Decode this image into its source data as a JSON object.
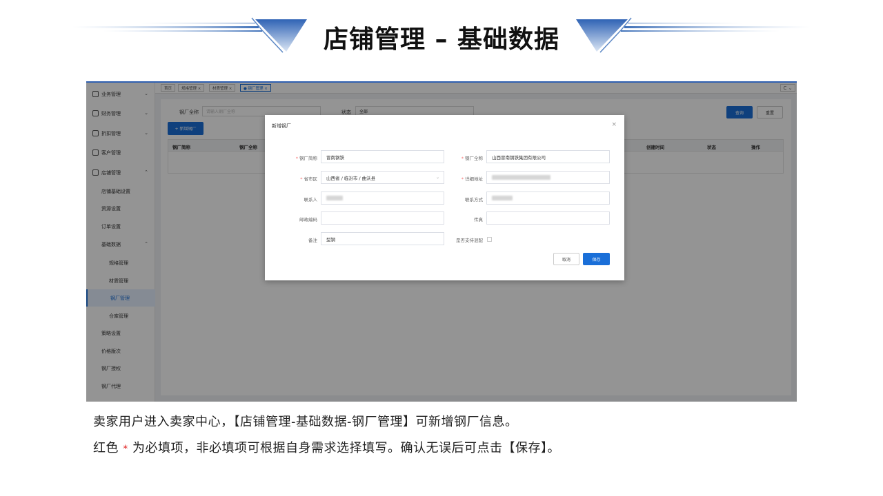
{
  "slide": {
    "title": "店铺管理 – 基础数据",
    "caption_line1": "卖家用户进入卖家中心，【店铺管理-基础数据-钢厂管理】可新增钢厂信息。",
    "caption_line2_before": "红色",
    "caption_line2_star": "*",
    "caption_line2_after": "为必填项，非必填项可根据自身需求选择填写。确认无误后可点击【保存】。"
  },
  "colors": {
    "primary": "#1a6fd8",
    "required": "#f56c6c",
    "accent_header": "#2f5fb0"
  },
  "sidebar": {
    "items": [
      {
        "label": "业务管理",
        "icon": "briefcase-icon",
        "chevron": "⌄"
      },
      {
        "label": "财务管理",
        "icon": "wallet-icon",
        "chevron": "⌄"
      },
      {
        "label": "折扣管理",
        "icon": "tag-icon",
        "chevron": "⌄"
      },
      {
        "label": "客户管理",
        "icon": "user-icon",
        "chevron": ""
      },
      {
        "label": "店铺管理",
        "icon": "shop-icon",
        "chevron": "⌃"
      }
    ],
    "sub_items": [
      "店铺基础设置",
      "资源设置",
      "订单设置",
      "基础数据"
    ],
    "sub_chevron": "⌃",
    "sub2_items": [
      "规格管理",
      "材质管理",
      "钢厂管理",
      "仓库管理"
    ],
    "tail_items": [
      "策略设置",
      "价格版次",
      "钢厂授权",
      "钢厂代理"
    ]
  },
  "tabs": {
    "items": [
      "首页",
      "规格管理 ×",
      "材质管理 ×",
      "● 钢厂管理 ×"
    ],
    "refresh": "C ⌄"
  },
  "filters": {
    "name_label": "钢厂全称",
    "name_placeholder": "请输入钢厂全称",
    "status_label": "状态",
    "status_value": "全部",
    "search_button": "查询",
    "reset_button": "重置",
    "add_button": "+ 新增钢厂"
  },
  "table": {
    "headers": [
      "钢厂简称",
      "钢厂全称",
      "创建时间",
      "状态",
      "操作"
    ]
  },
  "dialog": {
    "title": "新增钢厂",
    "close": "×",
    "fields": {
      "short_name": {
        "label": "钢厂简称",
        "required": "*",
        "value": "冒南钢铁"
      },
      "full_name": {
        "label": "钢厂全称",
        "required": "*",
        "value": "山西冒南钢铁集团有限公司"
      },
      "region": {
        "label": "省市区",
        "required": "*",
        "value": "山西省 / 临汾市 / 曲沃县",
        "arrow": "⌄"
      },
      "address": {
        "label": "详细地址",
        "required": "*",
        "value": ""
      },
      "contact": {
        "label": "联系人",
        "value": ""
      },
      "phone": {
        "label": "联系方式",
        "value": ""
      },
      "postcode": {
        "label": "邮政编码",
        "value": ""
      },
      "fax": {
        "label": "传真",
        "value": ""
      },
      "remark": {
        "label": "备注",
        "value": "型钢"
      },
      "support_match": {
        "label": "是否支持混配"
      }
    },
    "cancel_button": "取消",
    "save_button": "保存"
  }
}
